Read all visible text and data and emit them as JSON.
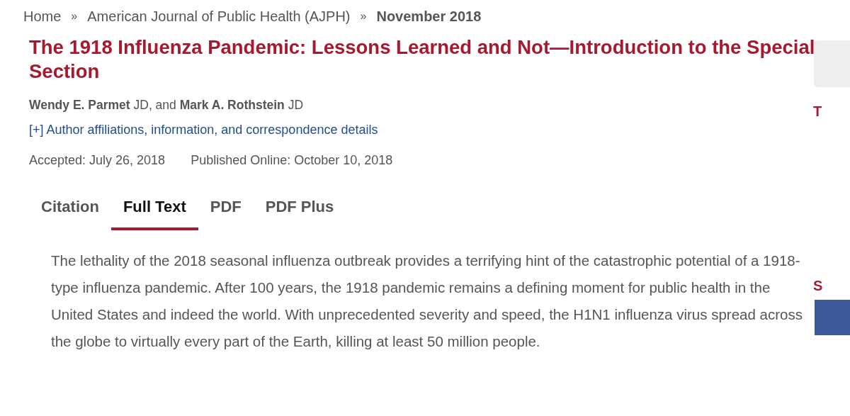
{
  "breadcrumbs": {
    "items": [
      {
        "label": "Home",
        "current": false
      },
      {
        "label": "American Journal of Public Health (AJPH)",
        "current": false
      },
      {
        "label": "November 2018",
        "current": true
      }
    ],
    "separators": [
      "»",
      "»"
    ]
  },
  "article": {
    "title": "The 1918 Influenza Pandemic: Lessons Learned and Not—Introduction to the Special Section",
    "authors": "**Wendy E. Parmet** JD, and **Mark A. Rothstein** JD",
    "affiliations_link": "[+] Author affiliations, information, and correspondence details",
    "accepted": "Accepted: July 26, 2018",
    "published": "Published Online: October 10, 2018",
    "tabs": [
      {
        "label": "Citation",
        "selected": false
      },
      {
        "label": "Full Text",
        "selected": true
      },
      {
        "label": "PDF",
        "selected": false
      },
      {
        "label": "PDF Plus",
        "selected": false
      }
    ],
    "body": "The lethality of the 2018 seasonal influenza outbreak provides a terrifying hint of the catastrophic potential of a 1918-type influenza pandemic. After 100 years, the 1918 pandemic remains a defining moment for public health in the United States and indeed the world. With unprecedented severity and speed, the H1N1 influenza virus spread across the globe to virtually every part of the Earth, killing at least 50 million people."
  },
  "sidebar": {
    "heading_1": "T",
    "heading_2": "S"
  }
}
